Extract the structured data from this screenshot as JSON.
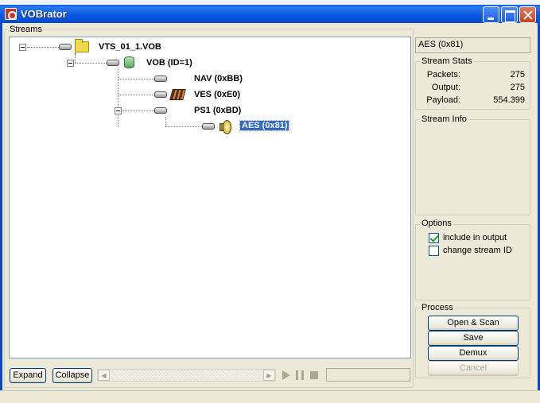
{
  "window": {
    "title": "VOBrator"
  },
  "streams": {
    "group_label": "Streams",
    "tree": [
      {
        "label": "VTS_01_1.VOB",
        "icon": "folder-icon",
        "level": 0
      },
      {
        "label": "VOB (ID=1)",
        "icon": "database-icon",
        "level": 1
      },
      {
        "label": "NAV (0xBB)",
        "icon": "none",
        "level": 2
      },
      {
        "label": "VES (0xE0)",
        "icon": "film-icon",
        "level": 2
      },
      {
        "label": "PS1 (0xBD)",
        "icon": "none",
        "level": 2
      },
      {
        "label": "AES (0x81)",
        "icon": "speaker-icon",
        "level": 3,
        "selected": true
      }
    ],
    "expand_label": "Expand",
    "collapse_label": "Collapse"
  },
  "right_panel": {
    "selected_stream": "AES (0x81)",
    "stats": {
      "group_label": "Stream Stats",
      "packets_label": "Packets:",
      "packets_value": "275",
      "output_label": "Output:",
      "output_value": "275",
      "payload_label": "Payload:",
      "payload_value": "554.399"
    },
    "info": {
      "group_label": "Stream Info"
    },
    "options": {
      "group_label": "Options",
      "include_label": "include in output",
      "include_checked": true,
      "change_id_label": "change stream ID",
      "change_id_checked": false
    },
    "process": {
      "group_label": "Process",
      "open_scan_label": "Open & Scan",
      "save_label": "Save",
      "demux_label": "Demux",
      "cancel_label": "Cancel"
    }
  },
  "colors": {
    "title_bar": "#0a5ee0",
    "selection": "#316ac5",
    "window_bg": "#ece9d8"
  }
}
